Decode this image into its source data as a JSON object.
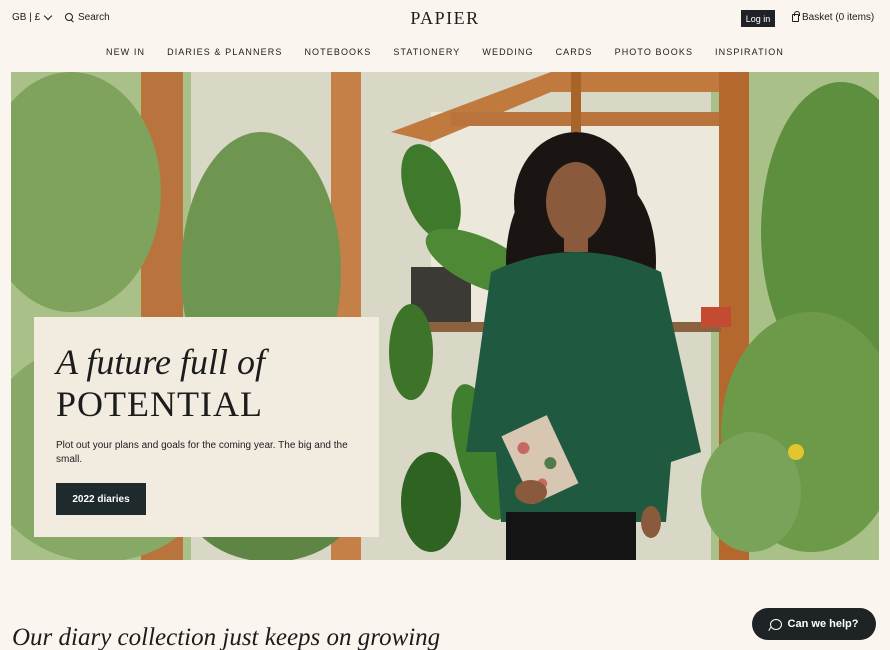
{
  "header": {
    "locale": "GB | £",
    "search_label": "Search",
    "logo": "PAPIER",
    "login_label": "Log in",
    "basket_label": "Basket (0 items)"
  },
  "nav": {
    "items": [
      "NEW IN",
      "DIARIES & PLANNERS",
      "NOTEBOOKS",
      "STATIONERY",
      "WEDDING",
      "CARDS",
      "PHOTO BOOKS",
      "INSPIRATION"
    ]
  },
  "hero": {
    "headline_line1": "A future full of",
    "headline_line2": "POTENTIAL",
    "text": "Plot out your plans and goals for the coming year. The big and the small.",
    "cta_label": "2022 diaries"
  },
  "section": {
    "title": "Our diary collection just keeps on growing"
  },
  "help": {
    "label": "Can we help?"
  },
  "colors": {
    "background": "#faf6ef",
    "card": "#f2ebe0",
    "button_dark": "#1e2a2c",
    "sweater_green": "#1f5a40",
    "greenhouse_wood": "#b8743c"
  }
}
